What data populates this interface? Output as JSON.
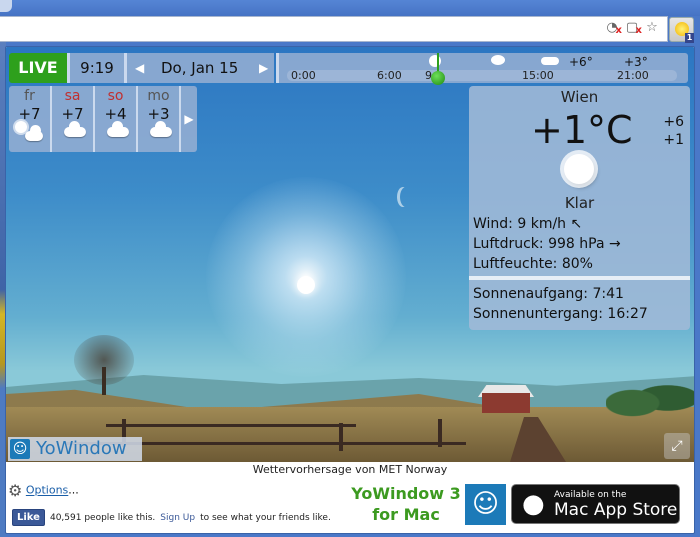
{
  "browser": {
    "extensions": [
      {
        "name": "cookie-blocked-icon"
      },
      {
        "name": "puzzle-blocked-icon"
      },
      {
        "name": "bookmark-star-icon"
      }
    ],
    "yowindow_badge": "1"
  },
  "topbar": {
    "live_label": "LIVE",
    "time": "9:19",
    "date": "Do, Jan 15",
    "prev_arrow": "◀",
    "next_arrow": "▶"
  },
  "timeline": {
    "ticks": [
      "0:00",
      "6:00",
      "9:",
      "15:00",
      "21:00"
    ],
    "temps": [
      "+6°",
      "+3°"
    ],
    "icons": [
      "sun-icon",
      "sun-cloud-icon",
      "cloud-icon"
    ]
  },
  "forecast": {
    "days": [
      {
        "name": "fr",
        "temp": "+7",
        "icon": "sun-cloud-icon",
        "weekend": false
      },
      {
        "name": "sa",
        "temp": "+7",
        "icon": "cloud-icon",
        "weekend": true
      },
      {
        "name": "so",
        "temp": "+4",
        "icon": "cloud-icon",
        "weekend": true
      },
      {
        "name": "mo",
        "temp": "+3",
        "icon": "cloud-icon",
        "weekend": false
      }
    ],
    "next_arrow": "▶"
  },
  "current": {
    "city": "Wien",
    "temperature": "+1°C",
    "high": "+6",
    "low": "+1",
    "condition": "Klar",
    "wind": "Wind:  9 km/h ↖",
    "pressure": "Luftdruck:  998 hPa →",
    "humidity": "Luftfeuchte:  80%",
    "sunrise": "Sonnenaufgang:  7:41",
    "sunset": "Sonnenuntergang:  16:27"
  },
  "brand": {
    "name": "YoWindow"
  },
  "footer": {
    "credit": "Wettervorhersage von MET Norway",
    "options_label": "Options",
    "options_suffix": "...",
    "fb_like": "Like",
    "fb_count_text": "40,591 people like this.",
    "fb_signup": "Sign Up",
    "fb_tail": "to see what your friends like.",
    "promo_line1": "YoWindow 3",
    "promo_line2": "for Mac",
    "appstore_line1": "Available on the",
    "appstore_line2": "Mac App Store"
  },
  "colors": {
    "live_green": "#2ea01c",
    "weekend_red": "#c03030",
    "promo_green": "#3c9a20",
    "brand_blue": "#1c7ab8"
  }
}
